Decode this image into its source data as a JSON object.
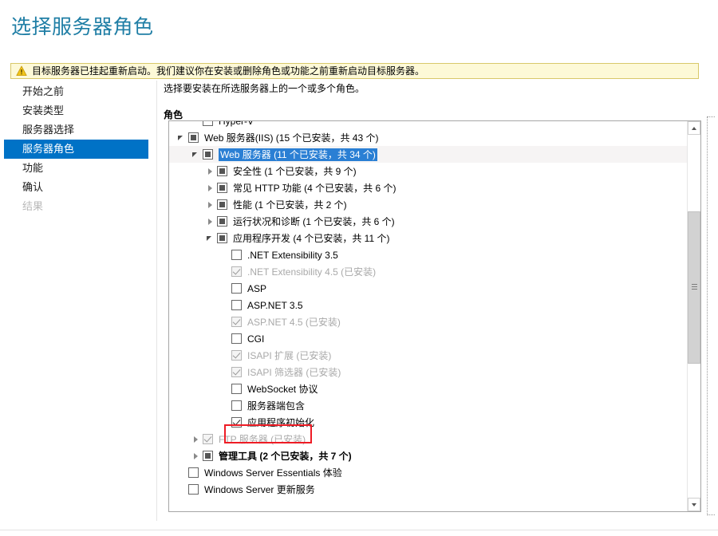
{
  "page": {
    "title": "选择服务器角色",
    "title_color": "#1f7ea5"
  },
  "warning": {
    "icon": "warning-triangle-icon",
    "text": "目标服务器已挂起重新启动。我们建议你在安装或删除角色或功能之前重新启动目标服务器。",
    "background": "#fdf9d7",
    "border_color": "#d8c86a"
  },
  "sidebar": {
    "selected_color": "#0072c6",
    "items": [
      {
        "label": "开始之前",
        "state": "normal"
      },
      {
        "label": "安装类型",
        "state": "normal"
      },
      {
        "label": "服务器选择",
        "state": "normal"
      },
      {
        "label": "服务器角色",
        "state": "selected"
      },
      {
        "label": "功能",
        "state": "normal"
      },
      {
        "label": "确认",
        "state": "normal"
      },
      {
        "label": "结果",
        "state": "disabled"
      }
    ]
  },
  "content": {
    "instruction": "选择要安装在所选服务器上的一个或多个角色。",
    "roles_label": "角色"
  },
  "tree": {
    "rows": [
      {
        "label": "Hyper-V",
        "indent": 1,
        "expander": "none",
        "check": "unchecked",
        "dim": false,
        "bold": false,
        "selected": false,
        "clipped": true
      },
      {
        "label": "Web 服务器(IIS) (15 个已安装，共 43 个)",
        "indent": 0,
        "expander": "expanded",
        "check": "partial",
        "dim": false,
        "bold": false,
        "selected": false
      },
      {
        "label": "Web 服务器 (11 个已安装，共 34 个)",
        "indent": 1,
        "expander": "expanded",
        "check": "partial",
        "dim": false,
        "bold": false,
        "selected": true
      },
      {
        "label": "安全性 (1 个已安装，共 9 个)",
        "indent": 2,
        "expander": "collapsed",
        "check": "partial",
        "dim": false,
        "bold": false,
        "selected": false
      },
      {
        "label": "常见 HTTP 功能 (4 个已安装，共 6 个)",
        "indent": 2,
        "expander": "collapsed",
        "check": "partial",
        "dim": false,
        "bold": false,
        "selected": false
      },
      {
        "label": "性能 (1 个已安装，共 2 个)",
        "indent": 2,
        "expander": "collapsed",
        "check": "partial",
        "dim": false,
        "bold": false,
        "selected": false
      },
      {
        "label": "运行状况和诊断 (1 个已安装，共 6 个)",
        "indent": 2,
        "expander": "collapsed",
        "check": "partial",
        "dim": false,
        "bold": false,
        "selected": false
      },
      {
        "label": "应用程序开发 (4 个已安装，共 11 个)",
        "indent": 2,
        "expander": "expanded",
        "check": "partial",
        "dim": false,
        "bold": false,
        "selected": false
      },
      {
        "label": ".NET Extensibility 3.5",
        "indent": 3,
        "expander": "none",
        "check": "unchecked",
        "dim": false,
        "bold": false,
        "selected": false
      },
      {
        "label": ".NET Extensibility 4.5 (已安装)",
        "indent": 3,
        "expander": "none",
        "check": "checked",
        "dim": true,
        "bold": false,
        "selected": false
      },
      {
        "label": "ASP",
        "indent": 3,
        "expander": "none",
        "check": "unchecked",
        "dim": false,
        "bold": false,
        "selected": false
      },
      {
        "label": "ASP.NET 3.5",
        "indent": 3,
        "expander": "none",
        "check": "unchecked",
        "dim": false,
        "bold": false,
        "selected": false
      },
      {
        "label": "ASP.NET 4.5 (已安装)",
        "indent": 3,
        "expander": "none",
        "check": "checked",
        "dim": true,
        "bold": false,
        "selected": false
      },
      {
        "label": "CGI",
        "indent": 3,
        "expander": "none",
        "check": "unchecked",
        "dim": false,
        "bold": false,
        "selected": false
      },
      {
        "label": "ISAPI 扩展 (已安装)",
        "indent": 3,
        "expander": "none",
        "check": "checked",
        "dim": true,
        "bold": false,
        "selected": false
      },
      {
        "label": "ISAPI 筛选器 (已安装)",
        "indent": 3,
        "expander": "none",
        "check": "checked",
        "dim": true,
        "bold": false,
        "selected": false
      },
      {
        "label": "WebSocket 协议",
        "indent": 3,
        "expander": "none",
        "check": "unchecked",
        "dim": false,
        "bold": false,
        "selected": false
      },
      {
        "label": "服务器端包含",
        "indent": 3,
        "expander": "none",
        "check": "unchecked",
        "dim": false,
        "bold": false,
        "selected": false
      },
      {
        "label": "应用程序初始化",
        "indent": 3,
        "expander": "none",
        "check": "checked",
        "dim": false,
        "bold": false,
        "selected": false,
        "annotated": true
      },
      {
        "label": "FTP 服务器 (已安装)",
        "indent": 1,
        "expander": "collapsed",
        "check": "checked",
        "dim": true,
        "bold": false,
        "selected": false
      },
      {
        "label": "管理工具 (2 个已安装，共 7 个)",
        "indent": 1,
        "expander": "collapsed",
        "check": "partial",
        "dim": false,
        "bold": true,
        "selected": false
      },
      {
        "label": "Windows Server Essentials 体验",
        "indent": 0,
        "expander": "none",
        "check": "unchecked",
        "dim": false,
        "bold": false,
        "selected": false
      },
      {
        "label": "Windows Server 更新服务",
        "indent": 0,
        "expander": "none",
        "check": "unchecked",
        "dim": false,
        "bold": false,
        "selected": false
      }
    ]
  },
  "scrollbar": {
    "up_arrow": "chevron-up-icon",
    "down_arrow": "chevron-down-icon",
    "thumb_top_pct": 21,
    "thumb_height_pct": 42
  },
  "annotation": {
    "color": "#ee1c25",
    "target": "应用程序初始化"
  }
}
